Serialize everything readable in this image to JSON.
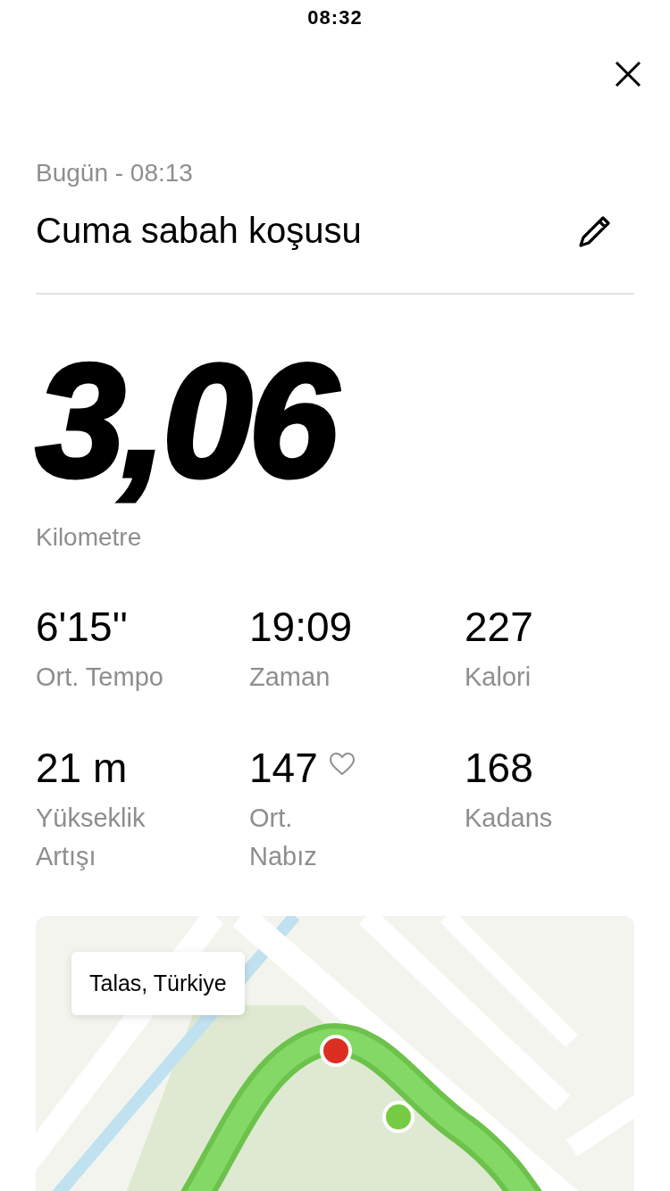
{
  "status_bar": {
    "time": "08:32"
  },
  "activity": {
    "date": "Bugün - 08:13",
    "title": "Cuma sabah koşusu"
  },
  "distance": {
    "value": "3,06",
    "unit": "Kilometre"
  },
  "stats": [
    {
      "value": "6'15''",
      "label": "Ort. Tempo",
      "kind": "plain"
    },
    {
      "value": "19:09",
      "label": "Zaman",
      "kind": "plain"
    },
    {
      "value": "227",
      "label": "Kalori",
      "kind": "plain"
    },
    {
      "value": "21 m",
      "label": "Yükseklik\nArtışı",
      "kind": "plain"
    },
    {
      "value": "147",
      "label": "Ort.\nNabız",
      "kind": "heart"
    },
    {
      "value": "168",
      "label": "Kadans",
      "kind": "plain"
    }
  ],
  "map": {
    "location": "Talas, Türkiye"
  }
}
